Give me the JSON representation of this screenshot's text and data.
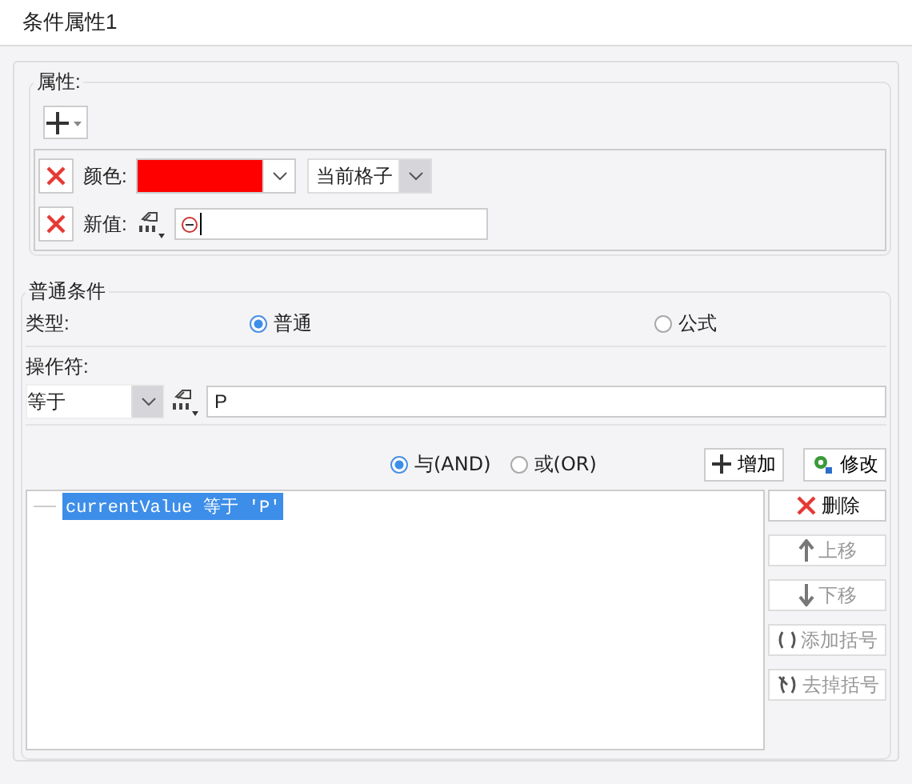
{
  "window": {
    "title": "条件属性1"
  },
  "properties": {
    "legend": "属性:",
    "rows": [
      {
        "kind": "color",
        "label": "颜色:",
        "color": "#ff0000",
        "scope": "当前格子"
      },
      {
        "kind": "value",
        "label": "新值:",
        "value": ""
      }
    ]
  },
  "condition": {
    "legend": "普通条件",
    "type_label": "类型:",
    "types": [
      {
        "label": "普通",
        "selected": true
      },
      {
        "label": "公式",
        "selected": false
      }
    ],
    "operator_label": "操作符:",
    "operator": "等于",
    "value": "P",
    "logic": [
      {
        "label": "与(AND)",
        "selected": true
      },
      {
        "label": "或(OR)",
        "selected": false
      }
    ],
    "add_button": "增加",
    "edit_button": "修改",
    "list": [
      {
        "text": "currentValue 等于 'P'",
        "selected": true
      }
    ],
    "buttons": [
      {
        "kind": "delete",
        "label": "删除",
        "disabled": false
      },
      {
        "kind": "up",
        "label": "上移",
        "disabled": true
      },
      {
        "kind": "down",
        "label": "下移",
        "disabled": true
      },
      {
        "kind": "add_paren",
        "label": "添加括号",
        "disabled": true
      },
      {
        "kind": "remove_paren",
        "label": "去掉括号",
        "disabled": true
      }
    ]
  }
}
